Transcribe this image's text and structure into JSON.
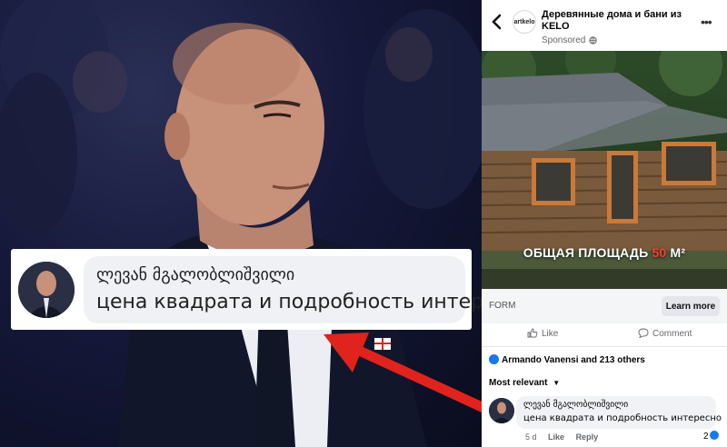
{
  "comment_zoom": {
    "author": "ლევან მგალობლიშვილი",
    "text": "цена квадрата и подробность интересно"
  },
  "ad": {
    "page_name": "Деревянные дома и бани из KELO",
    "sponsored_label": "Sponsored",
    "brand_logo_text": "artkelo",
    "caption_prefix": "ОБЩАЯ ПЛОЩАДЬ",
    "caption_value": "50",
    "caption_unit": "М²",
    "form_label": "FORM",
    "cta_label": "Learn more",
    "accent_color": "#ff3b30"
  },
  "actions": {
    "like_label": "Like",
    "comment_label": "Comment"
  },
  "reactions": {
    "summary": "Armando Vanensi and 213 others"
  },
  "sort": {
    "label": "Most relevant"
  },
  "comment": {
    "author": "ლევან მგალობლიშვილი",
    "text": "цена квадрата и подробность интересно",
    "age": "5 d",
    "like_label": "Like",
    "reply_label": "Reply",
    "reaction_count": "2"
  },
  "colors": {
    "facebook_blue": "#1877f2",
    "arrow_red": "#e0231c"
  }
}
